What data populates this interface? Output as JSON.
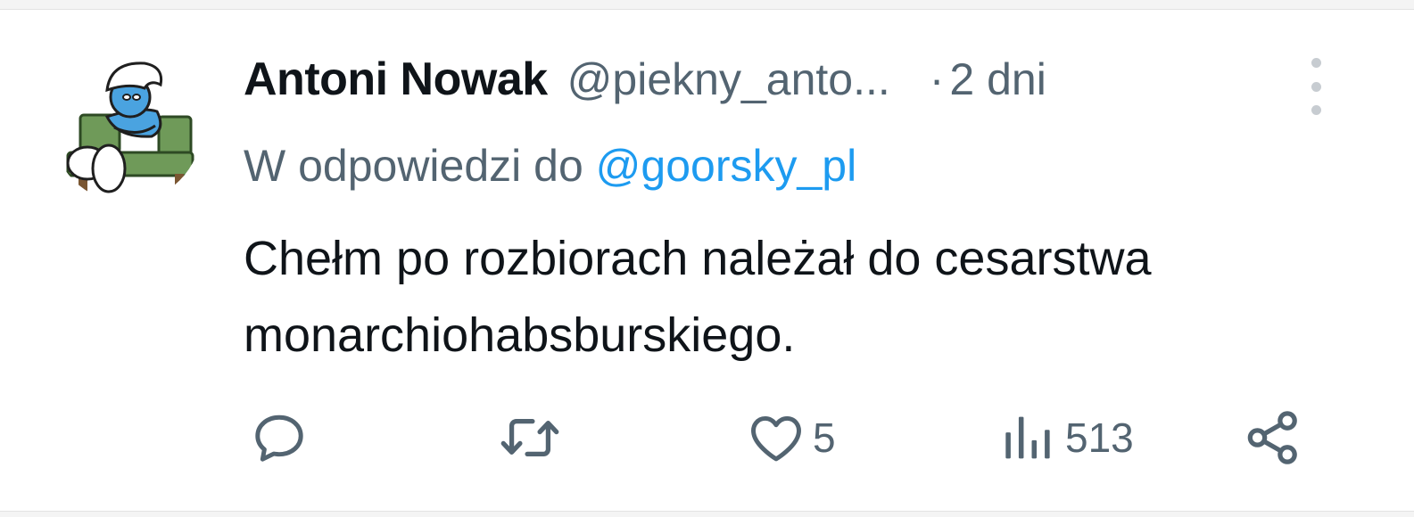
{
  "tweet": {
    "author": {
      "name": "Antoni Nowak",
      "handle": "@piekny_anto...",
      "avatar_icon": "smurf-on-bench-avatar"
    },
    "separator": "·",
    "time": "2 dni",
    "reply_prefix": "W odpowiedzi do",
    "reply_to": "@goorsky_pl",
    "text": "Chełm po rozbiorach należał do cesarstwa monarchiohabsburskiego."
  },
  "actions": {
    "reply": {
      "icon": "reply-icon",
      "count": ""
    },
    "retweet": {
      "icon": "retweet-icon",
      "count": ""
    },
    "like": {
      "icon": "heart-icon",
      "count": "5"
    },
    "views": {
      "icon": "views-icon",
      "count": "513"
    },
    "share": {
      "icon": "share-icon"
    }
  },
  "colors": {
    "text": "#0f1419",
    "secondary": "#536471",
    "link": "#1d9bf0",
    "more_dots": "#c7ccd1"
  }
}
